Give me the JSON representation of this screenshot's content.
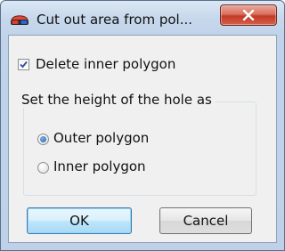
{
  "window": {
    "title": "Cut out area from pol...",
    "app_icon": "3d-glasses-icon",
    "close_icon": "close-icon"
  },
  "checkbox": {
    "label": "Delete inner polygon",
    "checked": true
  },
  "group": {
    "title": "Set the height of the hole as",
    "options": [
      {
        "label": "Outer polygon",
        "selected": true
      },
      {
        "label": "Inner polygon",
        "selected": false
      }
    ]
  },
  "buttons": {
    "ok": "OK",
    "cancel": "Cancel"
  }
}
